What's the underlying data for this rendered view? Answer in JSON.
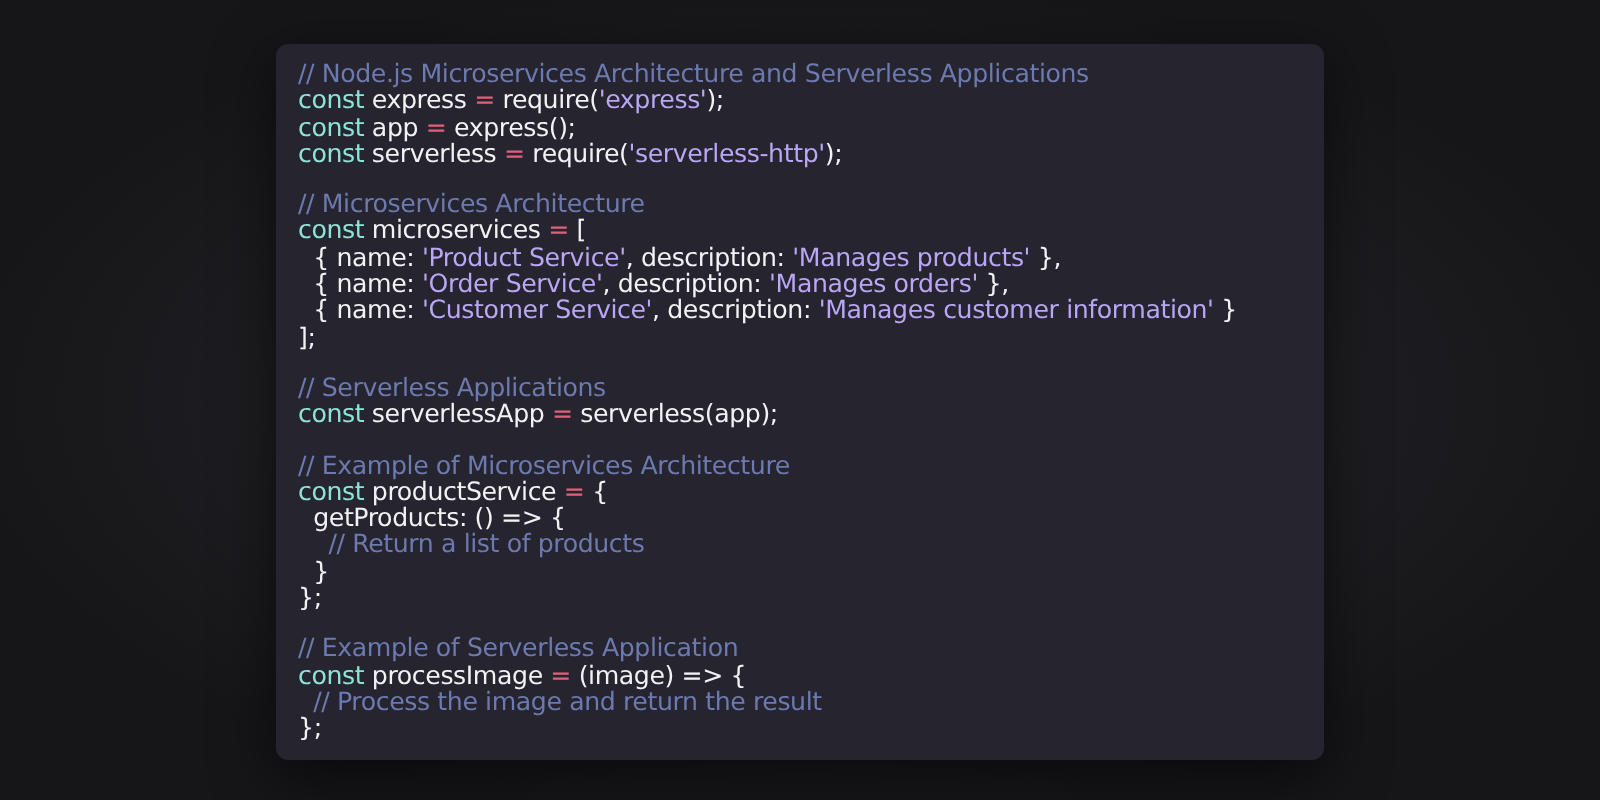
{
  "code_lines": [
    {
      "kind": "code",
      "tokens": [
        {
          "kind": "comment",
          "text": "// Node.js Microservices Architecture and Serverless Applications"
        }
      ]
    },
    {
      "kind": "code",
      "tokens": [
        {
          "kind": "keyword",
          "text": "const"
        },
        {
          "kind": "plain",
          "text": " express "
        },
        {
          "kind": "operator",
          "text": "="
        },
        {
          "kind": "plain",
          "text": " require("
        },
        {
          "kind": "string",
          "text": "'express'"
        },
        {
          "kind": "plain",
          "text": ");"
        }
      ]
    },
    {
      "kind": "code",
      "tokens": [
        {
          "kind": "keyword",
          "text": "const"
        },
        {
          "kind": "plain",
          "text": " app "
        },
        {
          "kind": "operator",
          "text": "="
        },
        {
          "kind": "plain",
          "text": " express();"
        }
      ]
    },
    {
      "kind": "code",
      "tokens": [
        {
          "kind": "keyword",
          "text": "const"
        },
        {
          "kind": "plain",
          "text": " serverless "
        },
        {
          "kind": "operator",
          "text": "="
        },
        {
          "kind": "plain",
          "text": " require("
        },
        {
          "kind": "string",
          "text": "'serverless-http'"
        },
        {
          "kind": "plain",
          "text": ");"
        }
      ]
    },
    {
      "kind": "blank"
    },
    {
      "kind": "code",
      "tokens": [
        {
          "kind": "comment",
          "text": "// Microservices Architecture"
        }
      ]
    },
    {
      "kind": "code",
      "tokens": [
        {
          "kind": "keyword",
          "text": "const"
        },
        {
          "kind": "plain",
          "text": " microservices "
        },
        {
          "kind": "operator",
          "text": "="
        },
        {
          "kind": "plain",
          "text": " ["
        }
      ]
    },
    {
      "kind": "code",
      "tokens": [
        {
          "kind": "plain",
          "text": "  { name: "
        },
        {
          "kind": "string",
          "text": "'Product Service'"
        },
        {
          "kind": "plain",
          "text": ", description: "
        },
        {
          "kind": "string",
          "text": "'Manages products'"
        },
        {
          "kind": "plain",
          "text": " },"
        }
      ]
    },
    {
      "kind": "code",
      "tokens": [
        {
          "kind": "plain",
          "text": "  { name: "
        },
        {
          "kind": "string",
          "text": "'Order Service'"
        },
        {
          "kind": "plain",
          "text": ", description: "
        },
        {
          "kind": "string",
          "text": "'Manages orders'"
        },
        {
          "kind": "plain",
          "text": " },"
        }
      ]
    },
    {
      "kind": "code",
      "tokens": [
        {
          "kind": "plain",
          "text": "  { name: "
        },
        {
          "kind": "string",
          "text": "'Customer Service'"
        },
        {
          "kind": "plain",
          "text": ", description: "
        },
        {
          "kind": "string",
          "text": "'Manages customer information'"
        },
        {
          "kind": "plain",
          "text": " }"
        }
      ]
    },
    {
      "kind": "code",
      "tokens": [
        {
          "kind": "plain",
          "text": "];"
        }
      ]
    },
    {
      "kind": "blank"
    },
    {
      "kind": "code",
      "tokens": [
        {
          "kind": "comment",
          "text": "// Serverless Applications"
        }
      ]
    },
    {
      "kind": "code",
      "tokens": [
        {
          "kind": "keyword",
          "text": "const"
        },
        {
          "kind": "plain",
          "text": " serverlessApp "
        },
        {
          "kind": "operator",
          "text": "="
        },
        {
          "kind": "plain",
          "text": " serverless(app);"
        }
      ]
    },
    {
      "kind": "blank"
    },
    {
      "kind": "code",
      "tokens": [
        {
          "kind": "comment",
          "text": "// Example of Microservices Architecture"
        }
      ]
    },
    {
      "kind": "code",
      "tokens": [
        {
          "kind": "keyword",
          "text": "const"
        },
        {
          "kind": "plain",
          "text": " productService "
        },
        {
          "kind": "operator",
          "text": "="
        },
        {
          "kind": "plain",
          "text": " {"
        }
      ]
    },
    {
      "kind": "code",
      "tokens": [
        {
          "kind": "plain",
          "text": "  getProducts: () => {"
        }
      ]
    },
    {
      "kind": "code",
      "tokens": [
        {
          "kind": "comment",
          "text": "    // Return a list of products"
        }
      ]
    },
    {
      "kind": "code",
      "tokens": [
        {
          "kind": "plain",
          "text": "  }"
        }
      ]
    },
    {
      "kind": "code",
      "tokens": [
        {
          "kind": "plain",
          "text": "};"
        }
      ]
    },
    {
      "kind": "blank"
    },
    {
      "kind": "code",
      "tokens": [
        {
          "kind": "comment",
          "text": "// Example of Serverless Application"
        }
      ]
    },
    {
      "kind": "code",
      "tokens": [
        {
          "kind": "keyword",
          "text": "const"
        },
        {
          "kind": "plain",
          "text": " processImage "
        },
        {
          "kind": "operator",
          "text": "="
        },
        {
          "kind": "plain",
          "text": " (image) => {"
        }
      ]
    },
    {
      "kind": "code",
      "tokens": [
        {
          "kind": "comment",
          "text": "  // Process the image and return the result"
        }
      ]
    },
    {
      "kind": "code",
      "tokens": [
        {
          "kind": "plain",
          "text": "};"
        }
      ]
    }
  ]
}
